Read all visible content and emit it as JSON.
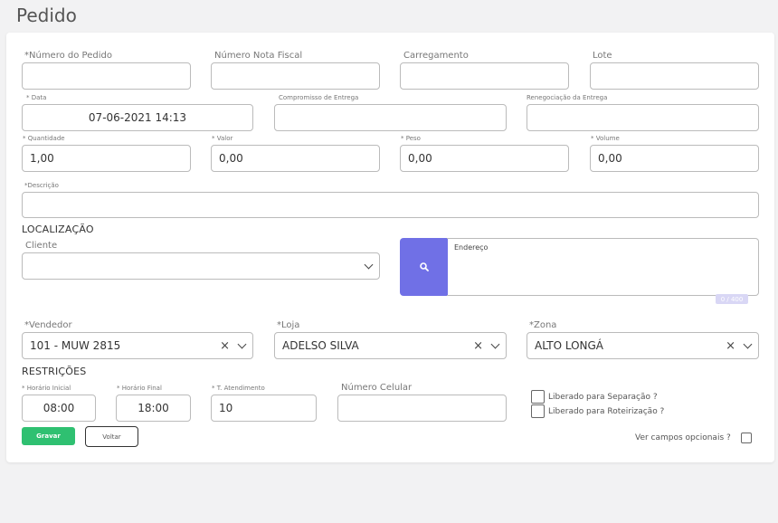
{
  "page": {
    "title": "Pedido"
  },
  "fields": {
    "numero_pedido": {
      "label": "*Número do Pedido",
      "value": ""
    },
    "nota_fiscal": {
      "label": "Número Nota Fiscal",
      "value": ""
    },
    "carregamento": {
      "label": "Carregamento",
      "value": ""
    },
    "lote": {
      "label": "Lote",
      "value": ""
    },
    "data": {
      "label": "* Data",
      "value": "07-06-2021 14:13"
    },
    "compromisso": {
      "label": "Compromisso de Entrega",
      "value": ""
    },
    "renegociacao": {
      "label": "Renegociação da Entrega",
      "value": ""
    },
    "quantidade": {
      "label": "* Quantidade",
      "value": "1,00"
    },
    "valor": {
      "label": "* Valor",
      "value": "0,00"
    },
    "peso": {
      "label": "* Peso",
      "value": "0,00"
    },
    "volume": {
      "label": "* Volume",
      "value": "0,00"
    },
    "descricao": {
      "label": "*Descrição",
      "value": ""
    }
  },
  "localizacao": {
    "title": "LOCALIZAÇÃO",
    "cliente_label": "Cliente",
    "cliente_value": "",
    "endereco_label": "Endereço",
    "counter": "0 / 400"
  },
  "selects": {
    "vendedor": {
      "label": "*Vendedor",
      "value": "101 - MUW 2815"
    },
    "loja": {
      "label": "*Loja",
      "value": "ADELSO SILVA"
    },
    "zona": {
      "label": "*Zona",
      "value": "ALTO LONGÁ"
    }
  },
  "restricoes": {
    "title": "RESTRIÇÕES",
    "horario_inicial": {
      "label": "* Horário Inicial",
      "value": "08:00"
    },
    "horario_final": {
      "label": "* Horário Final",
      "value": "18:00"
    },
    "atendimento": {
      "label": "* T. Atendimento",
      "value": "10"
    },
    "celular": {
      "label": "Número Celular",
      "value": ""
    },
    "liberado_separacao": "Liberado para Separação ?",
    "liberado_roteirizacao": "Liberado para Roteirização ?"
  },
  "actions": {
    "save": "Gravar",
    "back": "Voltar",
    "optional": "Ver campos opcionais ?"
  },
  "colors": {
    "search_button": "#7070e6",
    "save_button": "#2fc071"
  }
}
